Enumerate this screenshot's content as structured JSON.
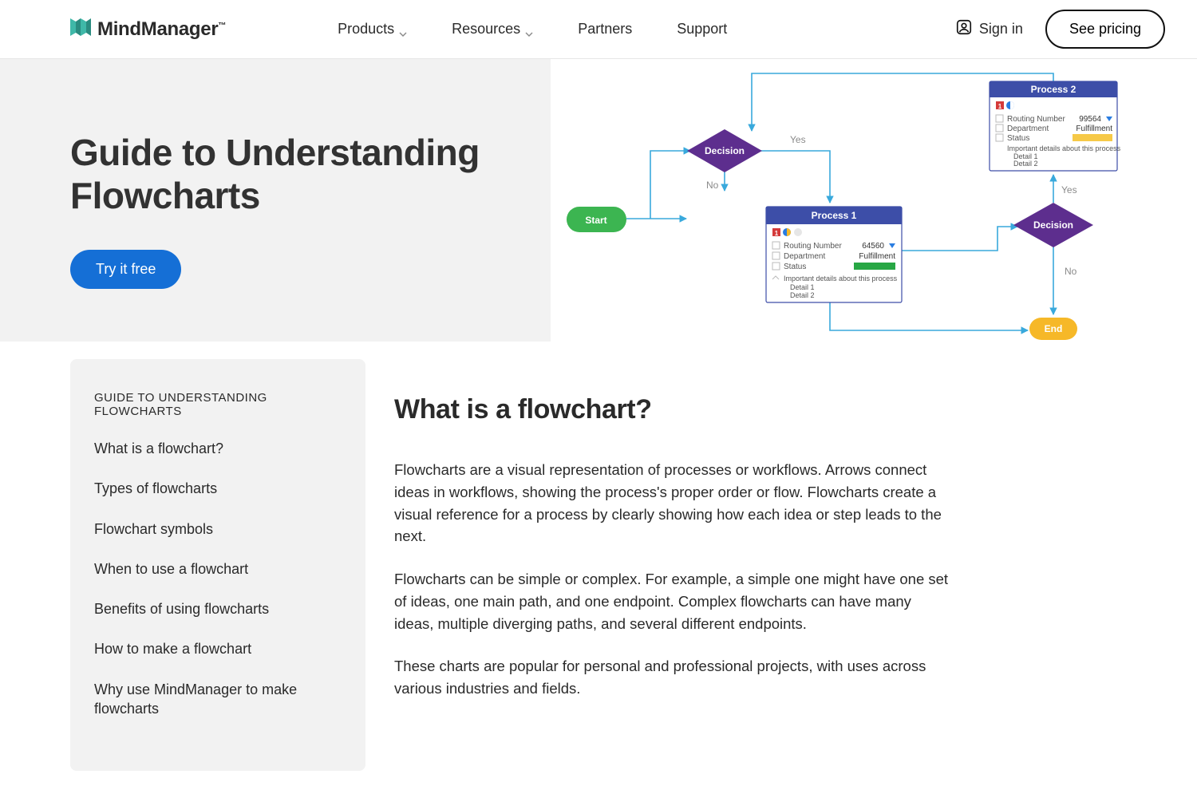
{
  "brand": {
    "name": "MindManager",
    "tm": "™"
  },
  "nav": {
    "products": "Products",
    "resources": "Resources",
    "partners": "Partners",
    "support": "Support"
  },
  "auth": {
    "signin": "Sign in",
    "pricing": "See pricing"
  },
  "hero": {
    "title_line1": "Guide to Understanding",
    "title_line2": "Flowcharts",
    "try": "Try it free"
  },
  "toc": {
    "title": "GUIDE TO UNDERSTANDING FLOWCHARTS",
    "items": [
      "What is a flowchart?",
      "Types of flowcharts",
      "Flowchart symbols",
      "When to use a flowchart",
      "Benefits of using flowcharts",
      "How to make a flowchart",
      "Why use MindManager to make flowcharts"
    ]
  },
  "article": {
    "heading": "What is a flowchart?",
    "p1": "Flowcharts are a visual representation of processes or workflows. Arrows connect ideas in workflows, showing the process's proper order or flow. Flowcharts create a visual reference for a process by clearly showing how each idea or step leads to the next.",
    "p2": "Flowcharts can be simple or complex. For example, a simple one might have one set of ideas, one main path, and one endpoint. Complex flowcharts can have many ideas, multiple diverging paths, and several different endpoints.",
    "p3": "These charts are popular for personal and professional projects, with uses across various industries and fields."
  },
  "flowchart": {
    "start": "Start",
    "decision": "Decision",
    "yes": "Yes",
    "no": "No",
    "end": "End",
    "process1": {
      "title": "Process 1",
      "routing_label": "Routing Number",
      "routing_value": "64560",
      "dept_label": "Department",
      "dept_value": "Fulfillment",
      "status_label": "Status",
      "note": "Important details about this process",
      "detail1": "Detail 1",
      "detail2": "Detail 2"
    },
    "process2": {
      "title": "Process 2",
      "routing_label": "Routing Number",
      "routing_value": "99564",
      "dept_label": "Department",
      "dept_value": "Fulfillment",
      "status_label": "Status",
      "note": "Important details about this process",
      "detail1": "Detail 1",
      "detail2": "Detail 2"
    }
  },
  "colors": {
    "accent_blue": "#156fd6",
    "start_green": "#3cb551",
    "decision_purple": "#5d2e8e",
    "process_header": "#3d4ea8",
    "end_yellow": "#f6b828",
    "connector": "#39a9dc"
  }
}
